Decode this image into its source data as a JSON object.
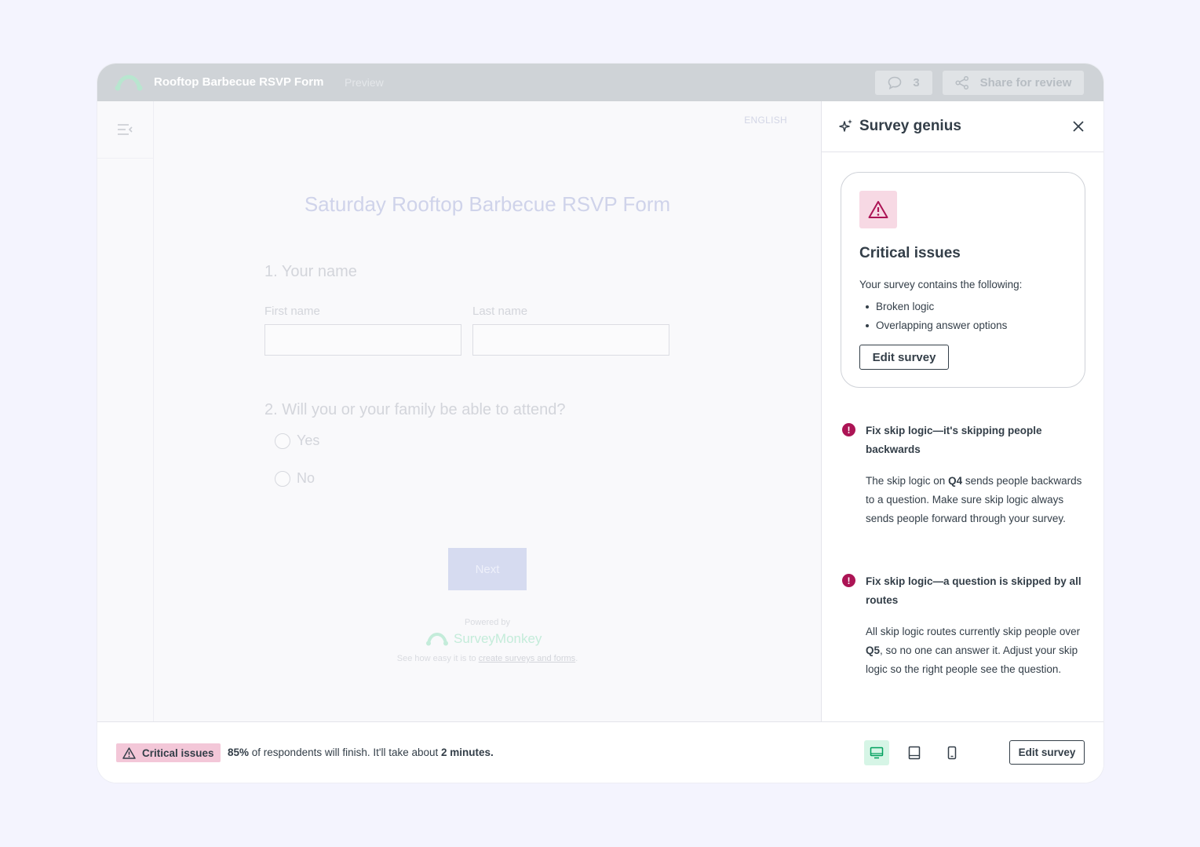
{
  "header": {
    "survey_title": "Rooftop Barbecue RSVP Form",
    "mode_label": "Preview",
    "comments_count": "3",
    "share_label": "Share for review",
    "logo_icon": "surveymonkey-logo-icon"
  },
  "preview": {
    "language": "ENGLISH",
    "form_title": "Saturday Rooftop Barbecue RSVP Form",
    "q1": {
      "title": "1. Your name",
      "first_label": "First name",
      "last_label": "Last name"
    },
    "q2": {
      "title": "2. Will you or your family be able to attend?",
      "options": [
        "Yes",
        "No"
      ]
    },
    "next_label": "Next",
    "powered_by": "Powered by",
    "brand": "SurveyMonkey",
    "tagline_prefix": "See how easy it is to ",
    "tagline_link": "create surveys and forms",
    "tagline_suffix": "."
  },
  "panel": {
    "title": "Survey genius",
    "card": {
      "title": "Critical issues",
      "intro": "Your survey contains the following:",
      "items": [
        "Broken logic",
        "Overlapping answer options"
      ],
      "button": "Edit survey"
    },
    "issues": [
      {
        "title": "Fix skip logic—it's skipping people backwards",
        "body_1": "The skip logic on ",
        "body_bold": "Q4",
        "body_2": " sends people backwards to a question. Make sure skip logic always sends people forward through your survey."
      },
      {
        "title": "Fix skip logic—a question is skipped by all routes",
        "body_1": "All skip logic routes currently skip people over ",
        "body_bold": "Q5",
        "body_2": ", so no one can answer it. Adjust your skip logic so the right people see the question."
      }
    ]
  },
  "footer": {
    "badge": "Critical issues",
    "pct": "85%",
    "text_1": " of respondents will finish. It'll take about ",
    "duration": "2 minutes.",
    "edit_button": "Edit survey",
    "devices": [
      "desktop-icon",
      "tablet-icon",
      "mobile-icon"
    ],
    "active_device": "desktop"
  },
  "colors": {
    "brand_green": "#00bf6f",
    "critical": "#ac1455",
    "critical_bg": "#f3c7d8",
    "text": "#333e48"
  }
}
